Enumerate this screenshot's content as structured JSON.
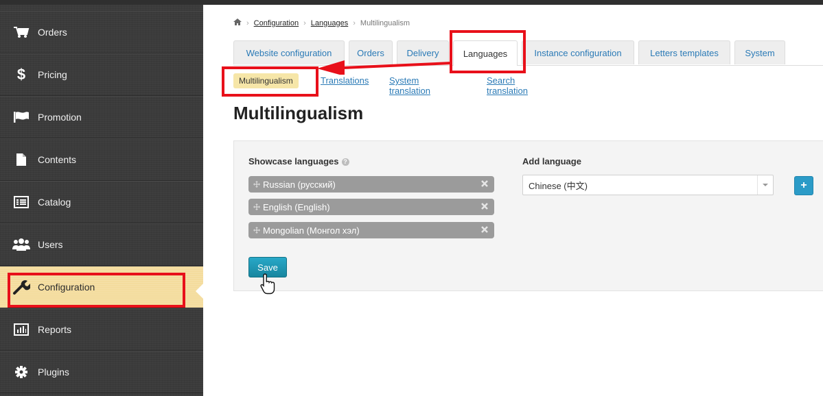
{
  "sidebar": {
    "items": [
      {
        "label": "Orders",
        "icon": "cart-icon"
      },
      {
        "label": "Pricing",
        "icon": "dollar-icon"
      },
      {
        "label": "Promotion",
        "icon": "flag-icon"
      },
      {
        "label": "Contents",
        "icon": "document-icon"
      },
      {
        "label": "Catalog",
        "icon": "list-icon"
      },
      {
        "label": "Users",
        "icon": "users-icon"
      },
      {
        "label": "Configuration",
        "icon": "wrench-icon",
        "active": true
      },
      {
        "label": "Reports",
        "icon": "chart-icon"
      },
      {
        "label": "Plugins",
        "icon": "gear-icon"
      }
    ]
  },
  "breadcrumb": {
    "home_icon": "home-icon",
    "items": [
      "Configuration",
      "Languages",
      "Multilingualism"
    ]
  },
  "tabs": [
    {
      "label": "Website configuration"
    },
    {
      "label": "Orders"
    },
    {
      "label": "Delivery"
    },
    {
      "label": "Languages",
      "active": true
    },
    {
      "label": "Instance configuration"
    },
    {
      "label": "Letters templates"
    },
    {
      "label": "System"
    }
  ],
  "subnav": {
    "active": "Multilingualism",
    "links": [
      "Translations",
      "System translation",
      "Search translation"
    ]
  },
  "page_title": "Multilingualism",
  "showcase": {
    "label": "Showcase languages",
    "languages": [
      "Russian (русский)",
      "English (English)",
      "Mongolian (Монгол хэл)"
    ]
  },
  "add_language": {
    "label": "Add language",
    "selected": "Chinese (中文)",
    "button": "+"
  },
  "save_label": "Save",
  "colors": {
    "accent": "#2b9bc7",
    "active_nav": "#f4dc9d",
    "highlight": "#e8101a",
    "link": "#2a7ab6"
  }
}
